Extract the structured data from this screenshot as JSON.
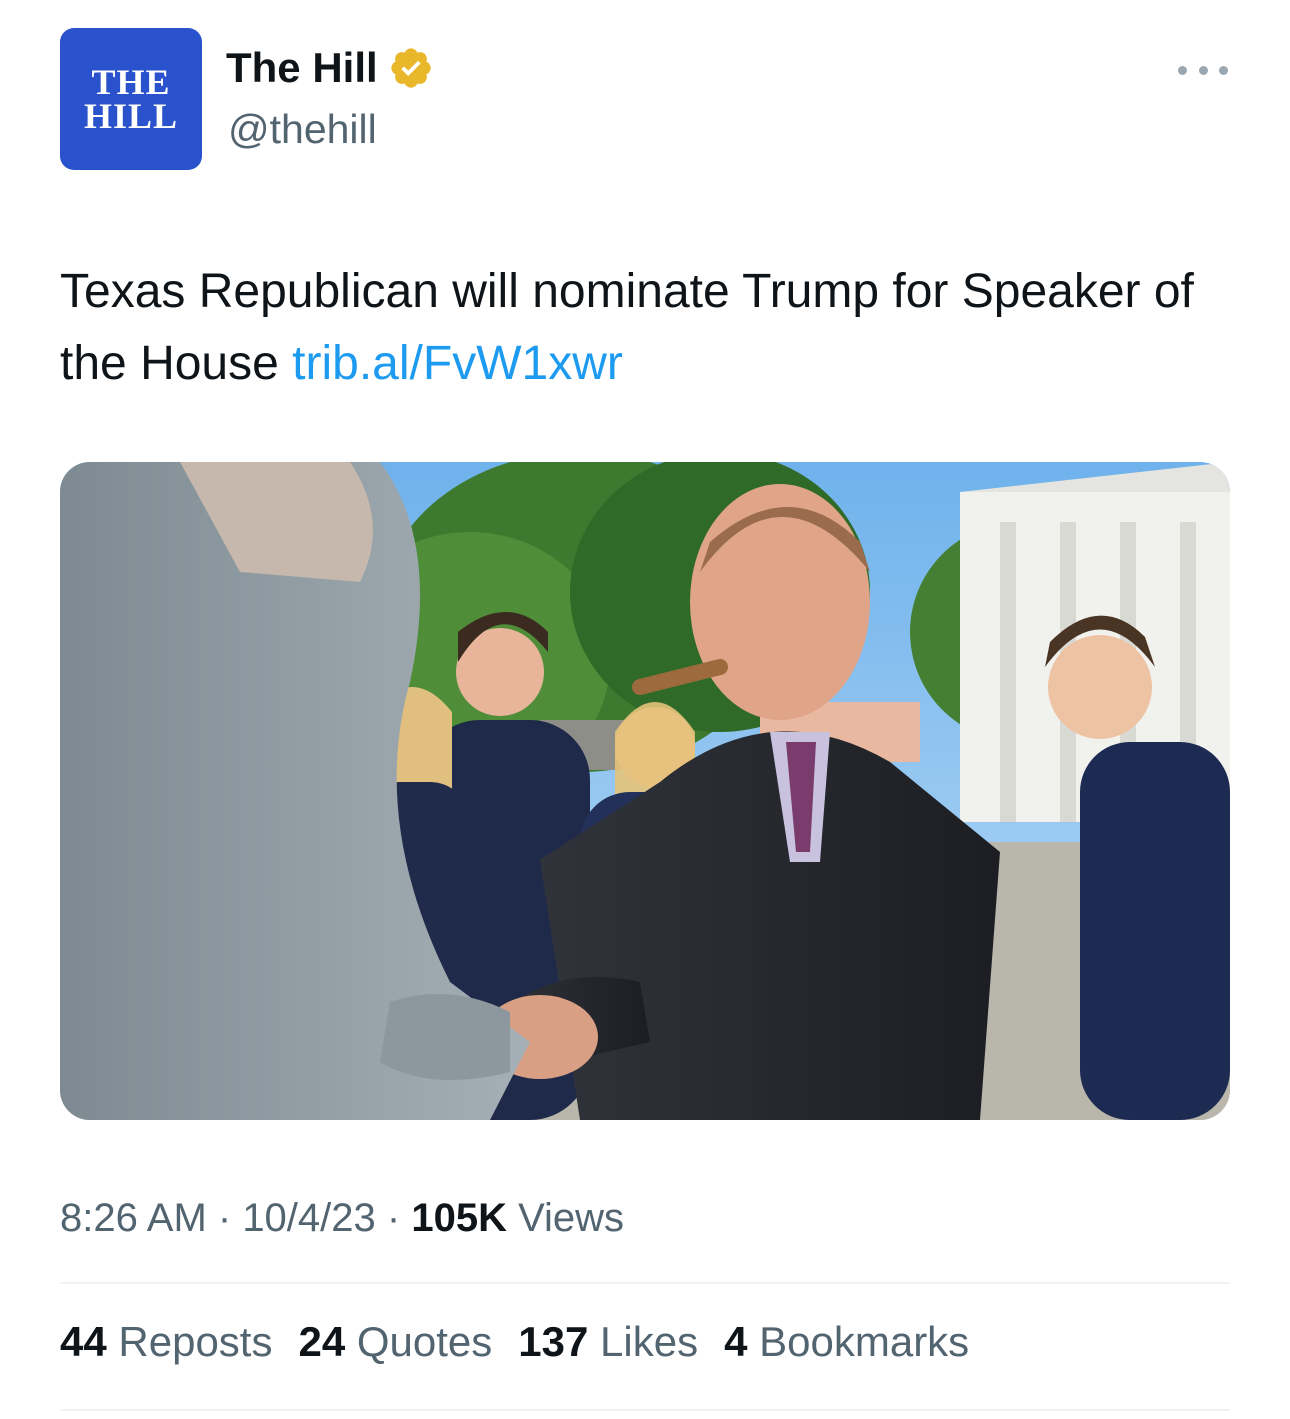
{
  "header": {
    "avatar_line1": "THE",
    "avatar_line2": "HILL",
    "display_name": "The Hill",
    "handle": "@thehill",
    "verified_badge_color": "#e8b82a",
    "avatar_color": "#2a52cc"
  },
  "tweet": {
    "text": "Texas Republican will nominate Trump for Speaker of the House ",
    "link": "trib.al/FvW1xwr",
    "link_color": "#1d9bf0"
  },
  "meta": {
    "time": "8:26 AM",
    "sep1": " · ",
    "date": "10/4/23",
    "sep2": " · ",
    "views_count": "105K",
    "views_label": " Views"
  },
  "stats": [
    {
      "count": "44",
      "label": "Reposts"
    },
    {
      "count": "24",
      "label": "Quotes"
    },
    {
      "count": "137",
      "label": "Likes"
    },
    {
      "count": "4",
      "label": "Bookmarks"
    }
  ]
}
